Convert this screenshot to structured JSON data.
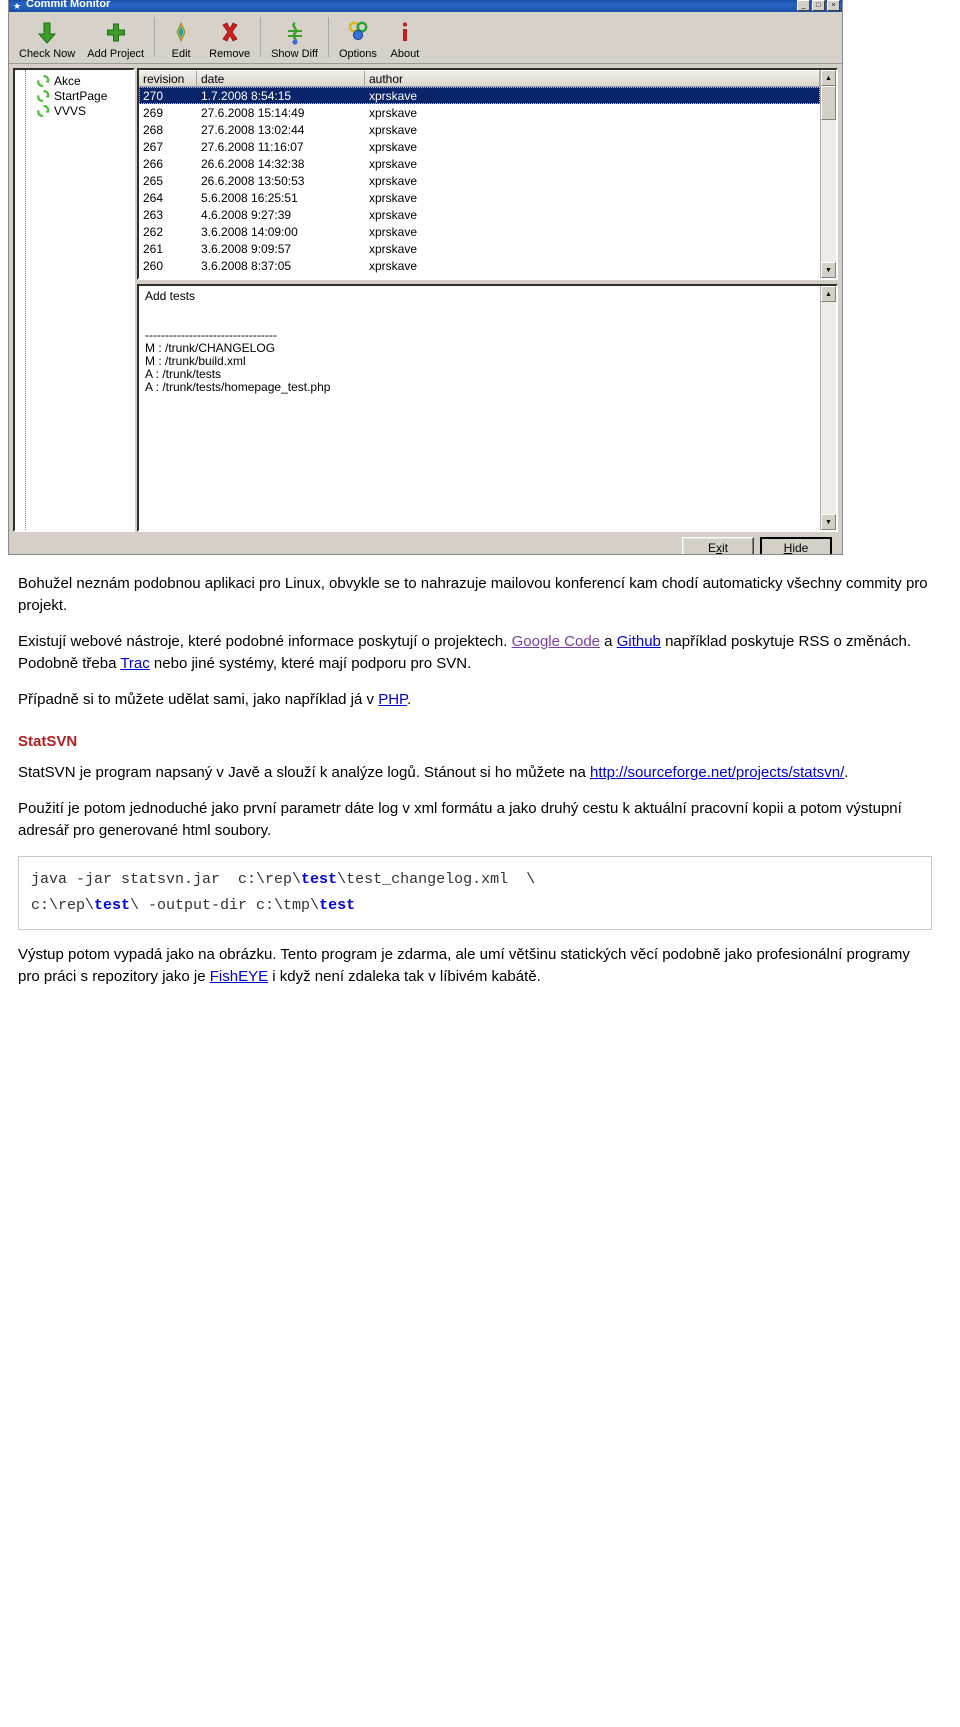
{
  "window": {
    "title": "Commit Monitor",
    "title_icon": "commit-monitor-icon",
    "minimize_glyph": "_",
    "maximize_glyph": "□",
    "close_glyph": "×"
  },
  "toolbar": {
    "items": [
      {
        "label": "Check Now",
        "icon": "down-arrow-icon"
      },
      {
        "label": "Add Project",
        "icon": "plus-icon"
      },
      {
        "label": "Edit",
        "icon": "diamond-edit-icon"
      },
      {
        "label": "Remove",
        "icon": "red-x-icon"
      },
      {
        "label": "Show Diff",
        "icon": "diff-icon"
      },
      {
        "label": "Options",
        "icon": "options-rings-icon"
      },
      {
        "label": "About",
        "icon": "info-icon"
      }
    ]
  },
  "tree": {
    "items": [
      {
        "label": "Akce",
        "icon": "project-recycle-icon"
      },
      {
        "label": "StartPage",
        "icon": "project-recycle-icon"
      },
      {
        "label": "VVVS",
        "icon": "project-recycle-icon"
      }
    ]
  },
  "revision_list": {
    "columns": [
      "revision",
      "date",
      "author"
    ],
    "rows": [
      {
        "revision": "270",
        "date": "1.7.2008 8:54:15",
        "author": "xprskave",
        "selected": true
      },
      {
        "revision": "269",
        "date": "27.6.2008 15:14:49",
        "author": "xprskave",
        "selected": false
      },
      {
        "revision": "268",
        "date": "27.6.2008 13:02:44",
        "author": "xprskave",
        "selected": false
      },
      {
        "revision": "267",
        "date": "27.6.2008 11:16:07",
        "author": "xprskave",
        "selected": false
      },
      {
        "revision": "266",
        "date": "26.6.2008 14:32:38",
        "author": "xprskave",
        "selected": false
      },
      {
        "revision": "265",
        "date": "26.6.2008 13:50:53",
        "author": "xprskave",
        "selected": false
      },
      {
        "revision": "264",
        "date": "5.6.2008 16:25:51",
        "author": "xprskave",
        "selected": false
      },
      {
        "revision": "263",
        "date": "4.6.2008 9:27:39",
        "author": "xprskave",
        "selected": false
      },
      {
        "revision": "262",
        "date": "3.6.2008 14:09:00",
        "author": "xprskave",
        "selected": false
      },
      {
        "revision": "261",
        "date": "3.6.2008 9:09:57",
        "author": "xprskave",
        "selected": false
      },
      {
        "revision": "260",
        "date": "3.6.2008 8:37:05",
        "author": "xprskave",
        "selected": false
      }
    ]
  },
  "message_pane": {
    "lines": [
      "Add tests",
      "",
      "",
      "---------------------------------",
      "M : /trunk/CHANGELOG",
      "M : /trunk/build.xml",
      "A : /trunk/tests",
      "A : /trunk/tests/homepage_test.php"
    ]
  },
  "footer": {
    "exit_label": "Exit",
    "exit_accel": "x",
    "hide_label": "Hide",
    "hide_accel": "H"
  },
  "article": {
    "p1": "Bohužel neznám podobnou aplikaci pro Linux, obvykle se to nahrazuje mailovou konferencí kam chodí automaticky všechny commity pro projekt.",
    "p2_a": "Existují webové nástroje, které podobné informace poskytují o projektech. ",
    "p2_link1": "Google Code",
    "p2_b": " a ",
    "p2_link2": "Github",
    "p2_c": " například poskytuje RSS o změnách. Podobně třeba ",
    "p2_link3": "Trac",
    "p2_d": " nebo jiné systémy, které mají podporu pro SVN.",
    "p3_a": "Případně si to můžete udělat sami, jako například já v ",
    "p3_link": "PHP",
    "p3_b": ".",
    "section_title": "StatSVN",
    "p4_a": "StatSVN je program napsaný v Javě a slouží k analýze logů. Stánout si ho můžete na ",
    "p4_link": "http://sourceforge.net/projects/statsvn/",
    "p4_b": ".",
    "p5": "Použití je potom jednoduché jako první parametr dáte log v xml formátu a jako druhý cestu k aktuální pracovní kopii a potom výstupní adresář pro generované html soubory.",
    "code": {
      "l1_a": "java -jar statsvn.jar  c:\\rep\\",
      "l1_b": "test",
      "l1_c": "\\test_changelog.xml  \\",
      "l2_a": "c:\\rep\\",
      "l2_b": "test",
      "l2_c": "\\ -output-dir c:\\tmp\\",
      "l2_d": "test"
    },
    "p6_a": "Výstup potom vypadá jako na obrázku. Tento program je zdarma, ale umí většinu statických věcí podobně jako profesionální programy pro práci s repozitory jako je ",
    "p6_link": "FishEYE",
    "p6_b": " i když není zdaleka tak v líbivém kabátě."
  },
  "colors": {
    "titlebar": "#1b4fa8",
    "selection": "#0a246a",
    "chrome": "#d4d0c8",
    "section_title": "#b02020",
    "link": "#0000cc",
    "link_visited": "#7a3f9d",
    "code_keyword": "#0000dd"
  }
}
